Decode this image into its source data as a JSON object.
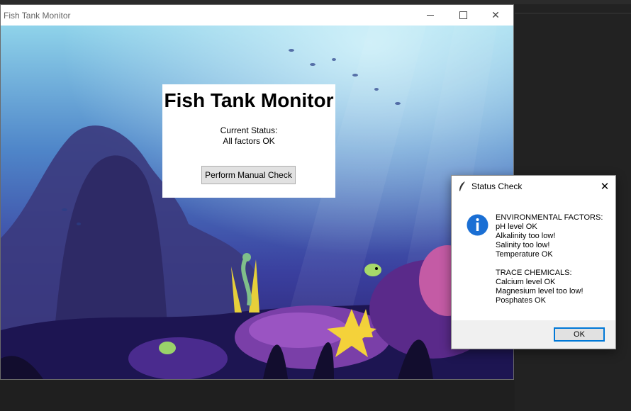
{
  "main_window": {
    "title": "Fish Tank Monitor",
    "panel": {
      "heading": "Fish Tank Monitor",
      "status_label": "Current Status:",
      "status_value": "All factors OK",
      "button_label": "Perform Manual Check"
    }
  },
  "dialog": {
    "title": "Status Check",
    "icon": "info-icon",
    "lines": [
      "ENVIRONMENTAL FACTORS:",
      "pH level OK",
      "Alkalinity too low!",
      "Salinity too low!",
      "Temperature OK",
      "",
      "TRACE CHEMICALS:",
      "Calcium level OK",
      "Magnesium level too low!",
      "Posphates OK"
    ],
    "ok_label": "OK"
  },
  "colors": {
    "accent": "#0078d7",
    "info_icon": "#1a6fd4"
  }
}
